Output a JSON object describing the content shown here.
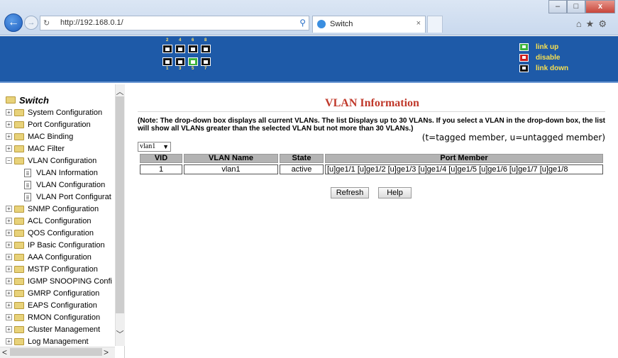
{
  "browser": {
    "url": "http://192.168.0.1/",
    "tab_title": "Switch",
    "win_minimize": "–",
    "win_maximize": "□",
    "win_close": "x",
    "toolbar_icons": "⌂★⚙",
    "tab_close": "×"
  },
  "banner": {
    "port_numbers_top": [
      "2",
      "4",
      "6",
      "8"
    ],
    "port_numbers_bottom": [
      "1",
      "3",
      "5",
      "7"
    ],
    "legend": [
      {
        "label": "link up",
        "color": "#3db33d"
      },
      {
        "label": "disable",
        "color": "#cc1f1f"
      },
      {
        "label": "link down",
        "color": "#111111"
      }
    ],
    "port_status": [
      "down",
      "down",
      "down",
      "down",
      "up",
      "down",
      "down",
      "down"
    ]
  },
  "sidebar": {
    "root": "Switch",
    "items": [
      {
        "label": "System Configuration",
        "type": "folder",
        "expanded": false
      },
      {
        "label": "Port Configuration",
        "type": "folder",
        "expanded": false
      },
      {
        "label": "MAC Binding",
        "type": "folder",
        "expanded": false
      },
      {
        "label": "MAC Filter",
        "type": "folder",
        "expanded": false
      },
      {
        "label": "VLAN Configuration",
        "type": "folder",
        "expanded": true
      },
      {
        "label": "VLAN Information",
        "type": "page"
      },
      {
        "label": "VLAN Configuration",
        "type": "page"
      },
      {
        "label": "VLAN Port Configurat",
        "type": "page"
      },
      {
        "label": "SNMP Configuration",
        "type": "folder",
        "expanded": false
      },
      {
        "label": "ACL Configuration",
        "type": "folder",
        "expanded": false
      },
      {
        "label": "QOS Configuration",
        "type": "folder",
        "expanded": false
      },
      {
        "label": "IP Basic Configuration",
        "type": "folder",
        "expanded": false
      },
      {
        "label": "AAA Configuration",
        "type": "folder",
        "expanded": false
      },
      {
        "label": "MSTP Configuration",
        "type": "folder",
        "expanded": false
      },
      {
        "label": "IGMP SNOOPING Confi",
        "type": "folder",
        "expanded": false
      },
      {
        "label": "GMRP Configuration",
        "type": "folder",
        "expanded": false
      },
      {
        "label": "EAPS Configuration",
        "type": "folder",
        "expanded": false
      },
      {
        "label": "RMON Configuration",
        "type": "folder",
        "expanded": false
      },
      {
        "label": "Cluster Management",
        "type": "folder",
        "expanded": false
      },
      {
        "label": "Log Management",
        "type": "folder",
        "expanded": false
      }
    ]
  },
  "main": {
    "title": "VLAN Information",
    "note": "(Note: The drop-down box displays all current VLANs. The list Displays up to 30 VLANs. If you select a VLAN in the drop-down box, the list will show all VLANs greater than the selected VLAN but not more than 30 VLANs.)",
    "tag_note": "(t=tagged member, u=untagged member)",
    "vlan_select": "vlan1",
    "columns": [
      "VID",
      "VLAN Name",
      "State",
      "Port Member"
    ],
    "rows": [
      {
        "vid": "1",
        "name": "vlan1",
        "state": "active",
        "ports": "[u]ge1/1 [u]ge1/2 [u]ge1/3 [u]ge1/4 [u]ge1/5 [u]ge1/6 [u]ge1/7 [u]ge1/8"
      }
    ],
    "refresh_label": "Refresh",
    "help_label": "Help"
  },
  "colors": {
    "banner": "#1e5aa8",
    "title": "#c0392b",
    "legend_text": "#f8e050"
  }
}
